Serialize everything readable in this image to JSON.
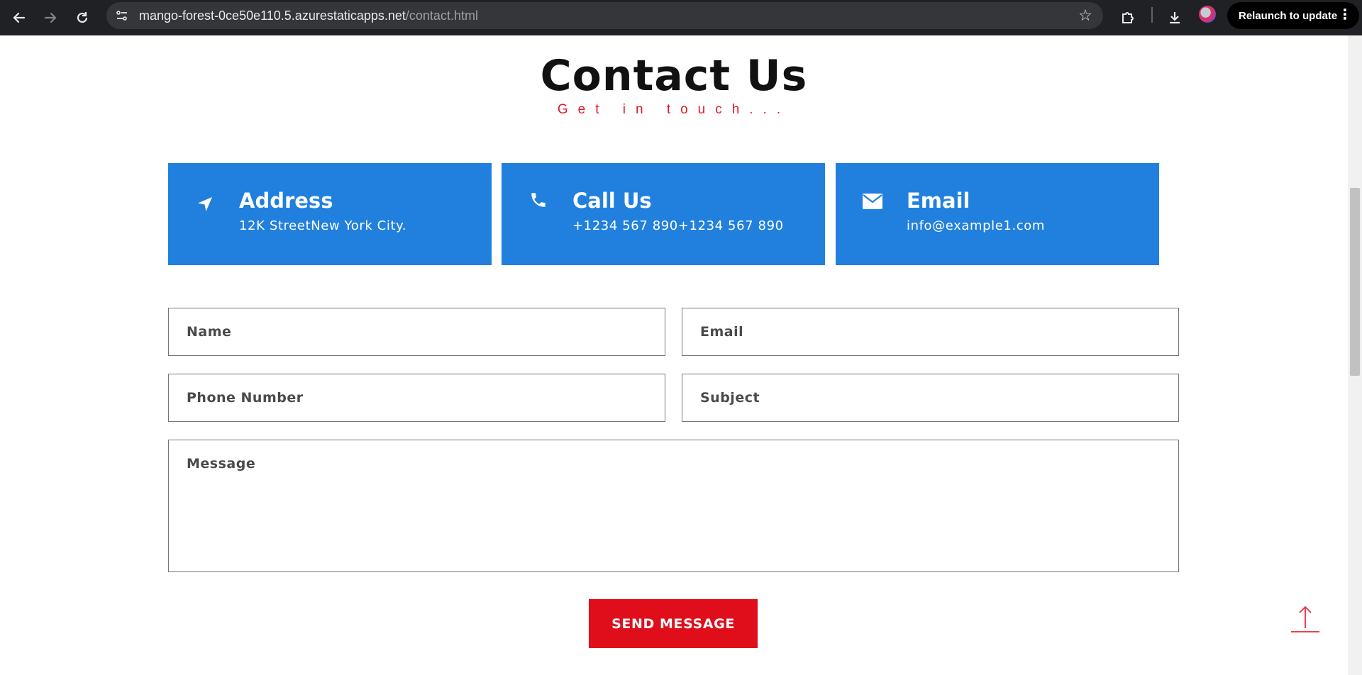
{
  "browser": {
    "url_host": "mango-forest-0ce50e110.5.azurestaticapps.net",
    "url_path": "/contact.html",
    "relaunch_label": "Relaunch to update"
  },
  "page": {
    "title": "Contact Us",
    "subtitle": "Get in touch..."
  },
  "cards": [
    {
      "title": "Address",
      "text": "12K StreetNew York City.",
      "icon": "location-arrow-icon"
    },
    {
      "title": "Call Us",
      "text": "+1234 567 890+1234 567 890",
      "icon": "phone-icon"
    },
    {
      "title": "Email",
      "text": "info@example1.com",
      "icon": "envelope-icon"
    }
  ],
  "form": {
    "name_placeholder": "Name",
    "email_placeholder": "Email",
    "phone_placeholder": "Phone Number",
    "subject_placeholder": "Subject",
    "message_placeholder": "Message",
    "submit_label": "SEND MESSAGE"
  },
  "colors": {
    "card_bg": "#2180de",
    "accent_red": "#e00e1b",
    "chrome_bg": "#202124"
  }
}
